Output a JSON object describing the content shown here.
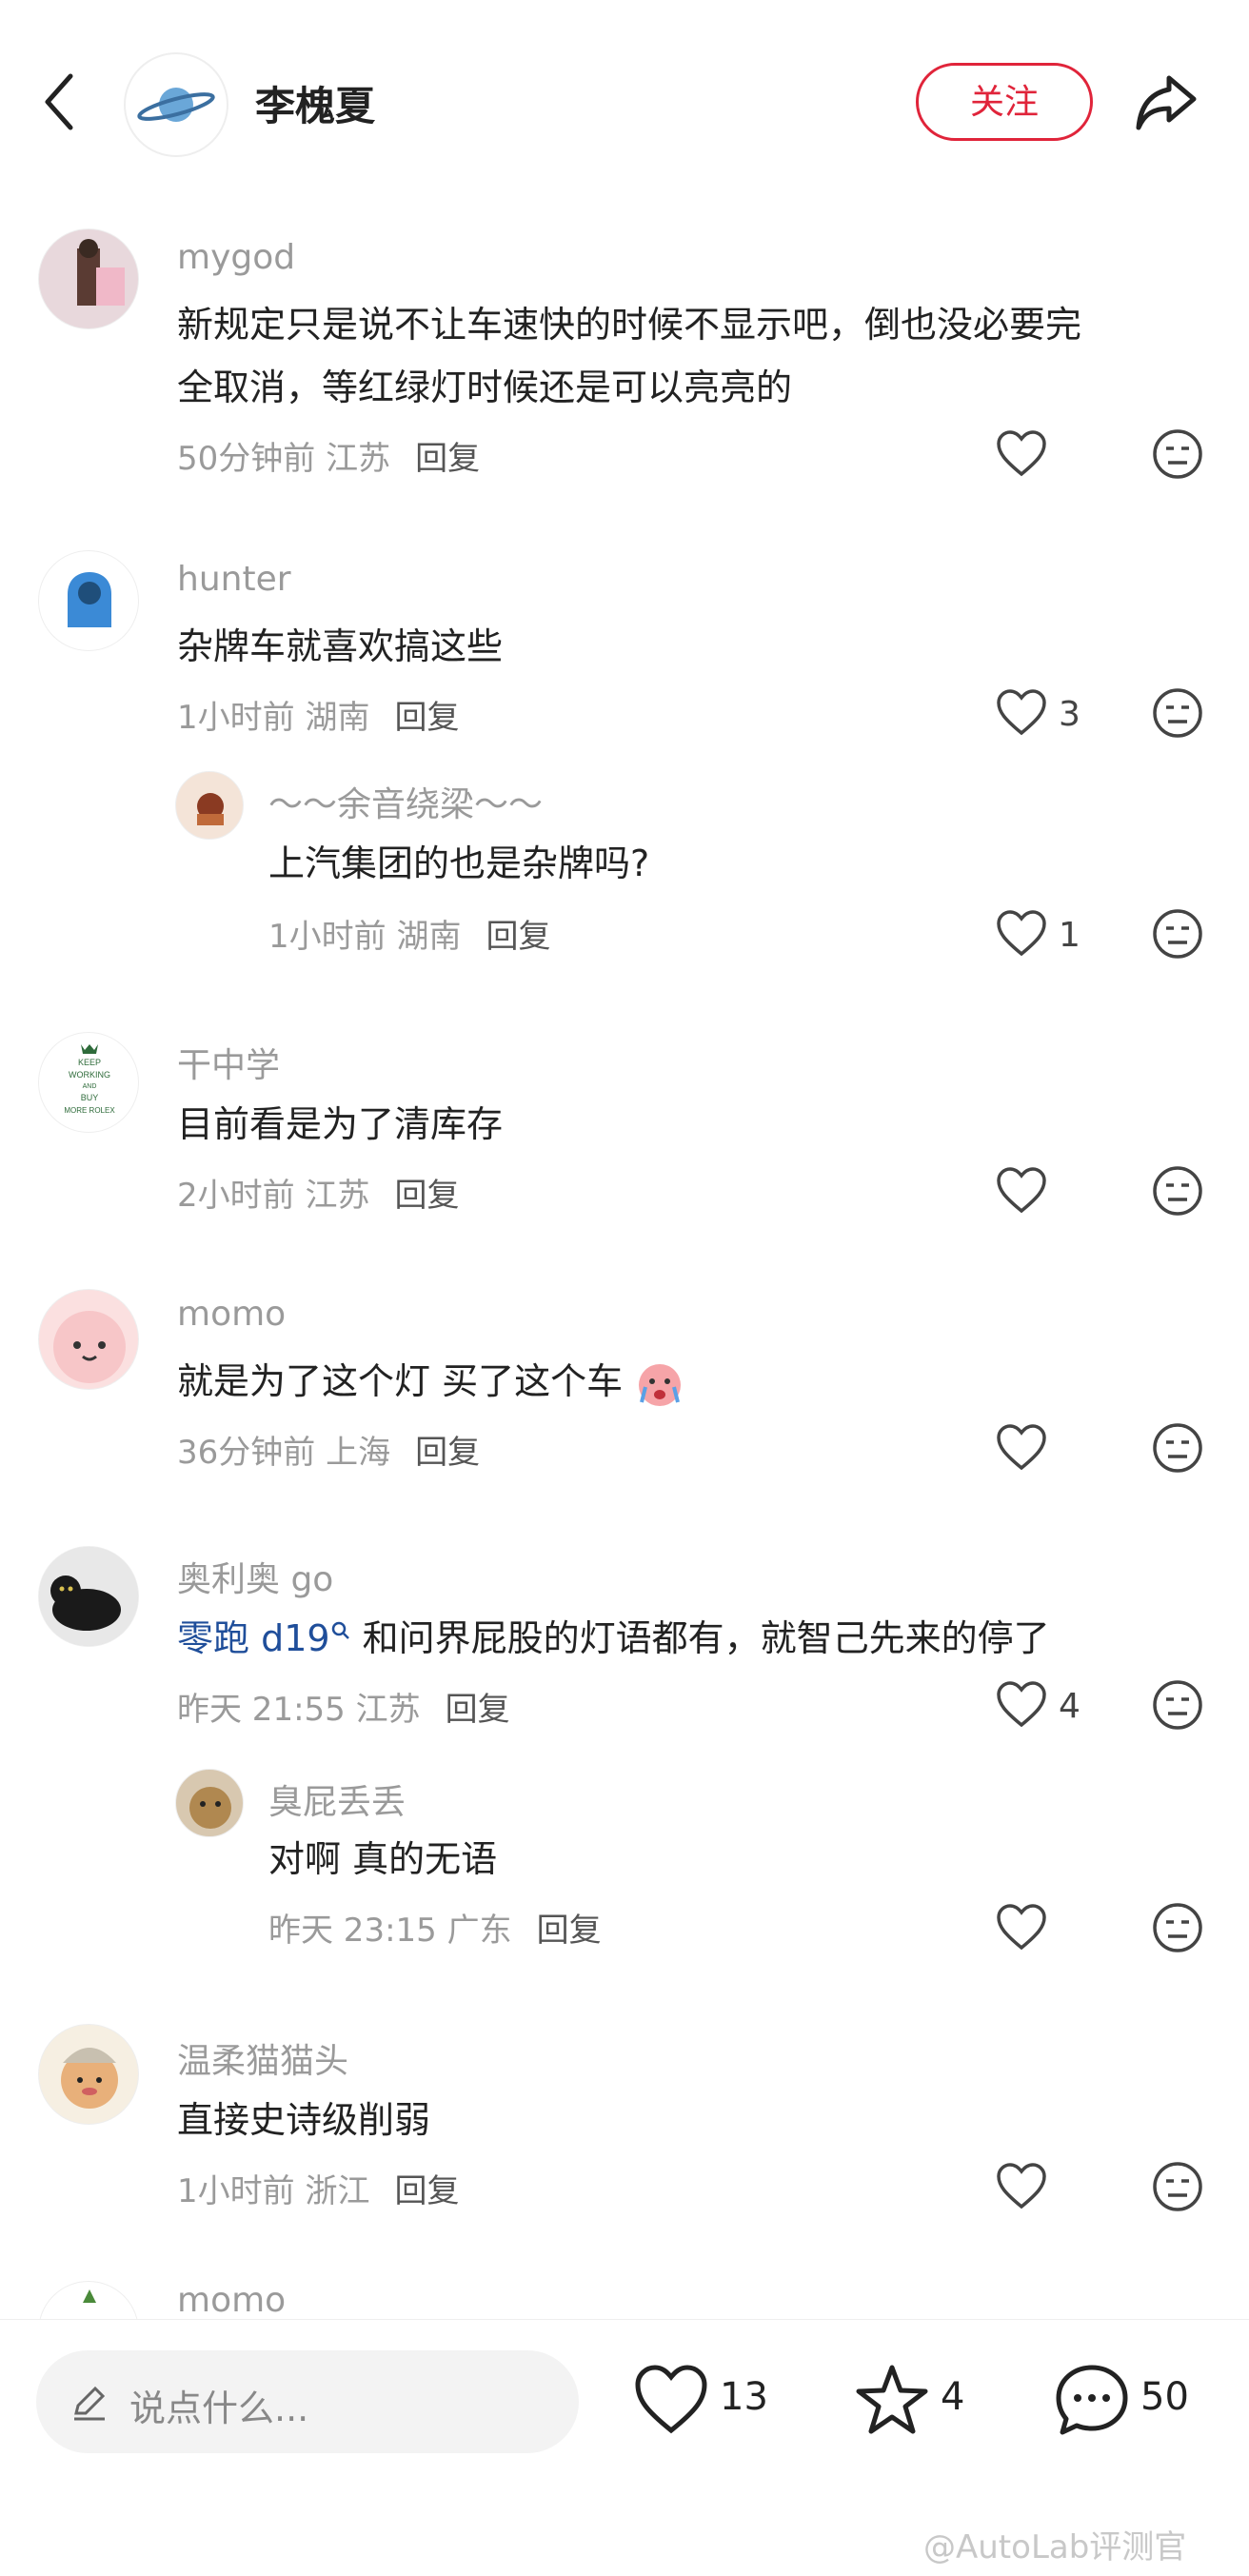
{
  "header": {
    "author_name": "李槐夏",
    "follow_label": "关注"
  },
  "comments": [
    {
      "name": "mygod",
      "text1": "新规定只是说不让车速快的时候不显示吧，倒也没必要完",
      "text2": "全取消，等红绿灯时候还是可以亮亮的",
      "time": "50分钟前 江苏",
      "reply": "回复",
      "likes": ""
    },
    {
      "name": "hunter",
      "text1": "杂牌车就喜欢搞这些",
      "time": "1小时前 湖南",
      "reply": "回复",
      "likes": "3"
    },
    {
      "name": "～～余音绕梁～～",
      "text1": "上汽集团的也是杂牌吗?",
      "time": "1小时前 湖南",
      "reply": "回复",
      "likes": "1"
    },
    {
      "name": "干中学",
      "text1": "目前看是为了清库存",
      "time": "2小时前 江苏",
      "reply": "回复",
      "likes": "",
      "avatar_text": [
        "KEEP",
        "WORKING",
        "AND",
        "BUY",
        "MORE ROLEX"
      ]
    },
    {
      "name": "momo",
      "text1": "就是为了这个灯 买了这个车",
      "time": "36分钟前 上海",
      "reply": "回复",
      "likes": ""
    },
    {
      "name": "奥利奥 go",
      "mention": "零跑 d19",
      "text1": " 和问界屁股的灯语都有，就智己先来的停了",
      "time": "昨天 21:55 江苏",
      "reply": "回复",
      "likes": "4"
    },
    {
      "name": "臭屁丢丢",
      "text1": "对啊 真的无语",
      "time": "昨天 23:15 广东",
      "reply": "回复",
      "likes": ""
    },
    {
      "name": "温柔猫猫头",
      "text1": "直接史诗级削弱",
      "time": "1小时前 浙江",
      "reply": "回复",
      "likes": ""
    },
    {
      "name": "momo"
    }
  ],
  "bottom": {
    "placeholder": "说点什么...",
    "likes": "13",
    "stars": "4",
    "comments": "50"
  },
  "watermark": "@AutoLab评测官"
}
